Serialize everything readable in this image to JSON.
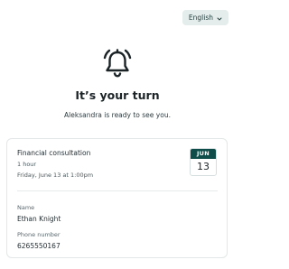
{
  "language_selector": {
    "label": "English",
    "icon": "chevron-down-icon"
  },
  "hero": {
    "icon": "bell-ringing-icon",
    "heading": "It’s your turn",
    "subheading": "Aleksandra is ready to see you."
  },
  "appointment": {
    "title": "Financial consultation",
    "duration": "1 hour",
    "datetime": "Friday, June 13 at 1:00pm",
    "calendar": {
      "month": "JUN",
      "day": "13"
    }
  },
  "details": {
    "name_label": "Name",
    "name_value": "Ethan Knight",
    "phone_label": "Phone number",
    "phone_value": "6265550167"
  },
  "colors": {
    "accent": "#0f4d4a",
    "language_bg": "#e4edec"
  }
}
